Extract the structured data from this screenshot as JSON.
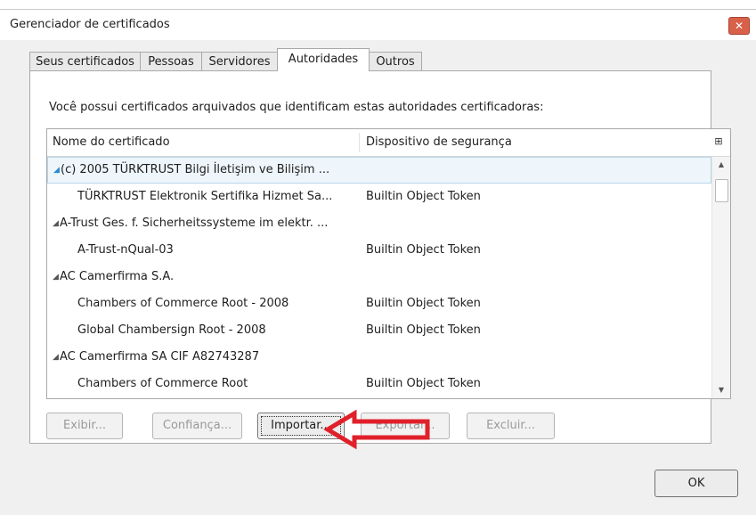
{
  "window": {
    "title": "Gerenciador de certificados",
    "close_glyph": "✕"
  },
  "tabs": [
    {
      "label": "Seus certificados",
      "active": false
    },
    {
      "label": "Pessoas",
      "active": false
    },
    {
      "label": "Servidores",
      "active": false
    },
    {
      "label": "Autoridades",
      "active": true
    },
    {
      "label": "Outros",
      "active": false
    }
  ],
  "intro_text": "Você possui certificados arquivados que identificam estas autoridades certificadoras:",
  "tree": {
    "columns": {
      "name": "Nome do certificado",
      "device": "Dispositivo de segurança",
      "picker_icon": "column-picker-icon"
    },
    "rows": [
      {
        "type": "group",
        "name": "(c) 2005 TÜRKTRUST Bilgi İletişim ve Bilişim ...",
        "device": "",
        "selected": true
      },
      {
        "type": "child",
        "name": "TÜRKTRUST Elektronik Sertifika Hizmet Sa...",
        "device": "Builtin Object Token"
      },
      {
        "type": "group",
        "name": "A-Trust Ges. f. Sicherheitssysteme im elektr. ...",
        "device": ""
      },
      {
        "type": "child",
        "name": "A-Trust-nQual-03",
        "device": "Builtin Object Token"
      },
      {
        "type": "group",
        "name": "AC Camerfirma S.A.",
        "device": ""
      },
      {
        "type": "child",
        "name": "Chambers of Commerce Root - 2008",
        "device": "Builtin Object Token"
      },
      {
        "type": "child",
        "name": "Global Chambersign Root - 2008",
        "device": "Builtin Object Token"
      },
      {
        "type": "group",
        "name": "AC Camerfirma SA CIF A82743287",
        "device": ""
      },
      {
        "type": "child",
        "name": "Chambers of Commerce Root",
        "device": "Builtin Object Token"
      }
    ]
  },
  "buttons": {
    "view": "Exibir...",
    "trust": "Confiança...",
    "import": "Importar...",
    "export": "Exportar...",
    "delete": "Excluir...",
    "ok": "OK"
  },
  "colors": {
    "annotation_arrow": "#e0202a",
    "selection": "#eef6fb",
    "close_button": "#d9614a"
  }
}
